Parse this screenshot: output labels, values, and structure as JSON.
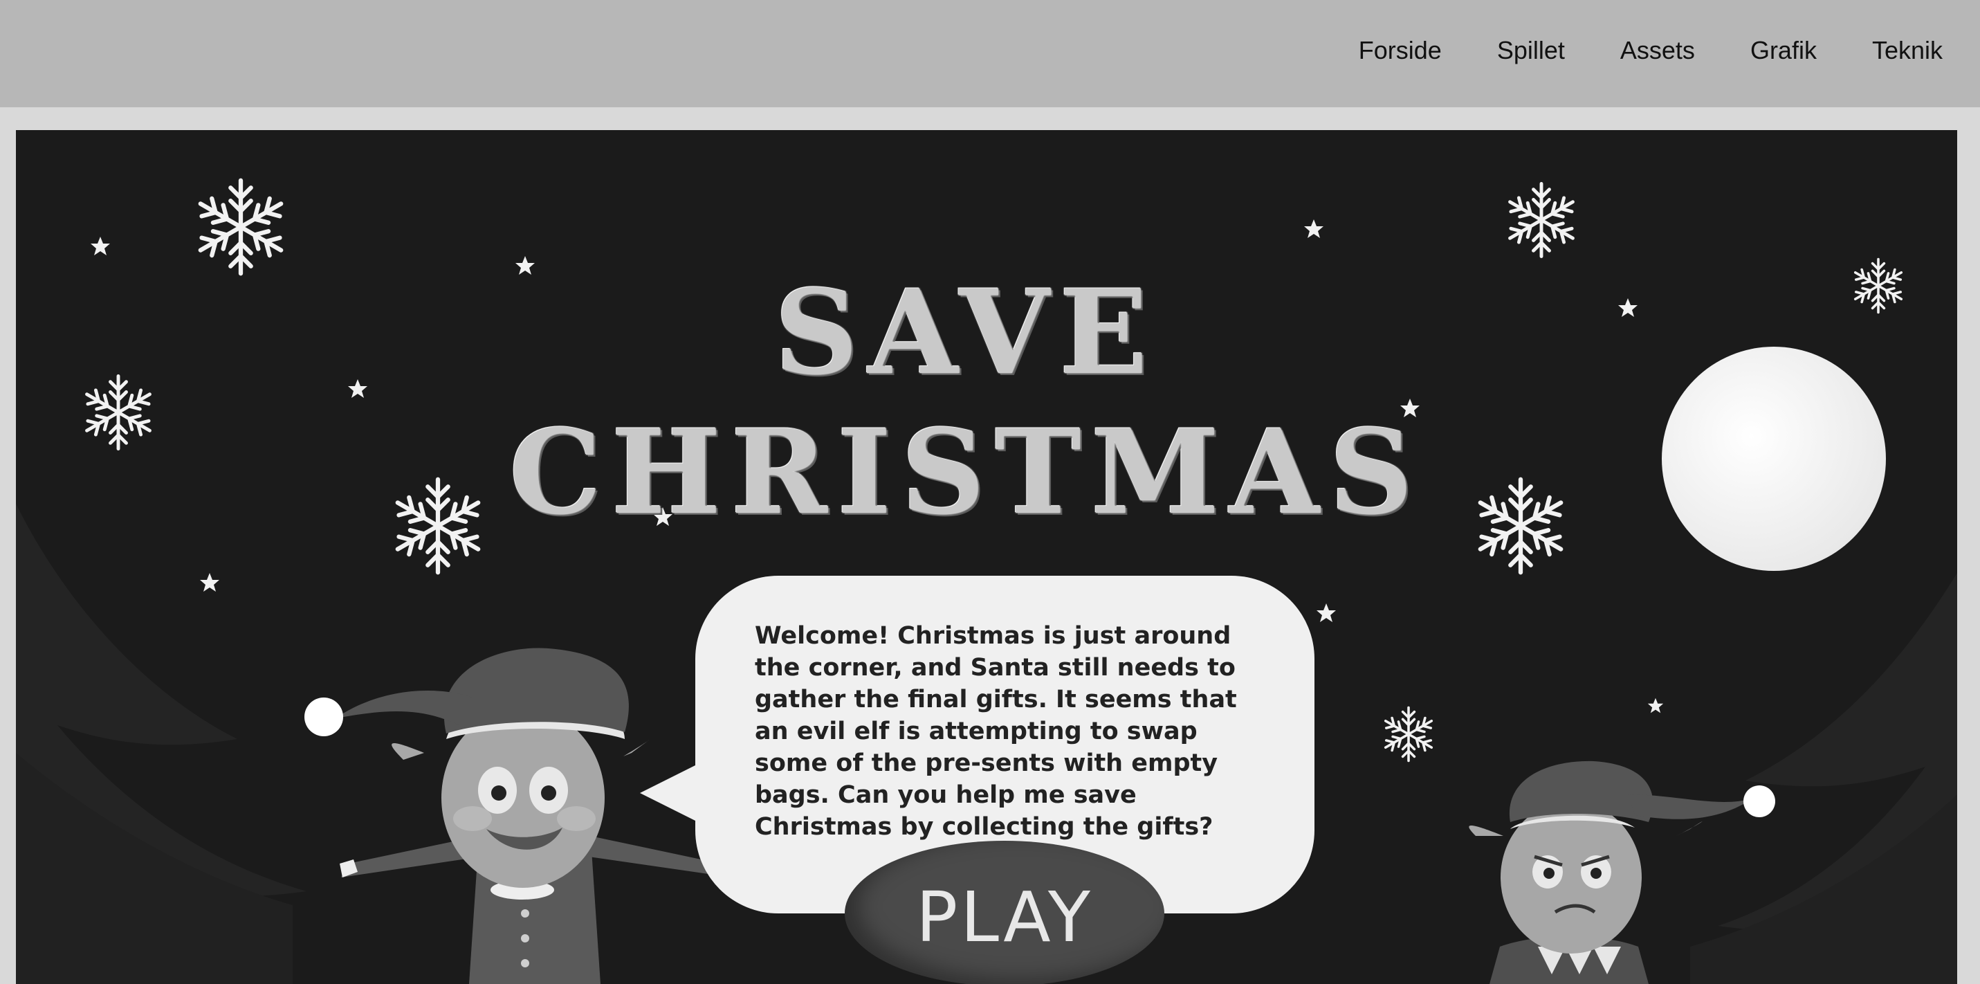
{
  "nav": {
    "items": [
      {
        "label": "Forside"
      },
      {
        "label": "Spillet"
      },
      {
        "label": "Assets"
      },
      {
        "label": "Grafik"
      },
      {
        "label": "Teknik"
      }
    ]
  },
  "game": {
    "title_line1": "SAVE",
    "title_line2": "CHRISTMAS",
    "speech": "Welcome! Christmas is just around the corner, and Santa still needs to gather the final gifts. It seems that an evil elf is attempting to swap some of the pre-sents with empty bags. Can you help me save Christmas by collecting the gifts?",
    "play_label": "PLAY"
  },
  "colors": {
    "header_bg": "#b7b7b7",
    "page_bg": "#d9d9d9",
    "scene_bg": "#1b1b1b",
    "moon": "#f5f5f5",
    "bubble": "#f0f0f0"
  }
}
